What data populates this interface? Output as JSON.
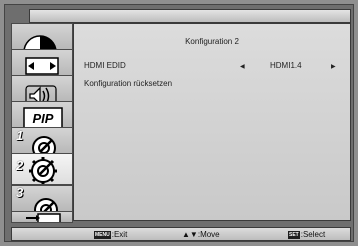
{
  "panel": {
    "title": "Konfiguration 2",
    "items": [
      {
        "label": "HDMI EDID",
        "value": "HDMI1.4",
        "left_arrow": "◀",
        "right_arrow": "▶"
      },
      {
        "label": "Konfiguration rücksetzen"
      }
    ]
  },
  "sidebar": {
    "items": [
      {
        "name": "picture",
        "icon": "picture-icon"
      },
      {
        "name": "screen",
        "icon": "screen-icon"
      },
      {
        "name": "audio",
        "icon": "speaker-icon"
      },
      {
        "name": "pip",
        "icon": "pip-icon",
        "label": "PIP"
      },
      {
        "name": "configuration-1",
        "icon": "settings-1-icon",
        "number": "1"
      },
      {
        "name": "configuration-2",
        "icon": "settings-2-icon",
        "number": "2",
        "selected": true
      },
      {
        "name": "configuration-3",
        "icon": "settings-3-icon",
        "number": "3"
      },
      {
        "name": "input",
        "icon": "input-icon"
      }
    ]
  },
  "footer": {
    "exit_key": "MENU",
    "exit_label": ":Exit",
    "move_keys": "▲▼",
    "move_label": ":Move",
    "select_key": "SET",
    "select_label": ":Select"
  },
  "colors": {
    "panel_bg": "#d5d5d5",
    "frame_bg": "#6e6e6e",
    "icon_fill": "#ffffff",
    "icon_stroke": "#000000"
  }
}
